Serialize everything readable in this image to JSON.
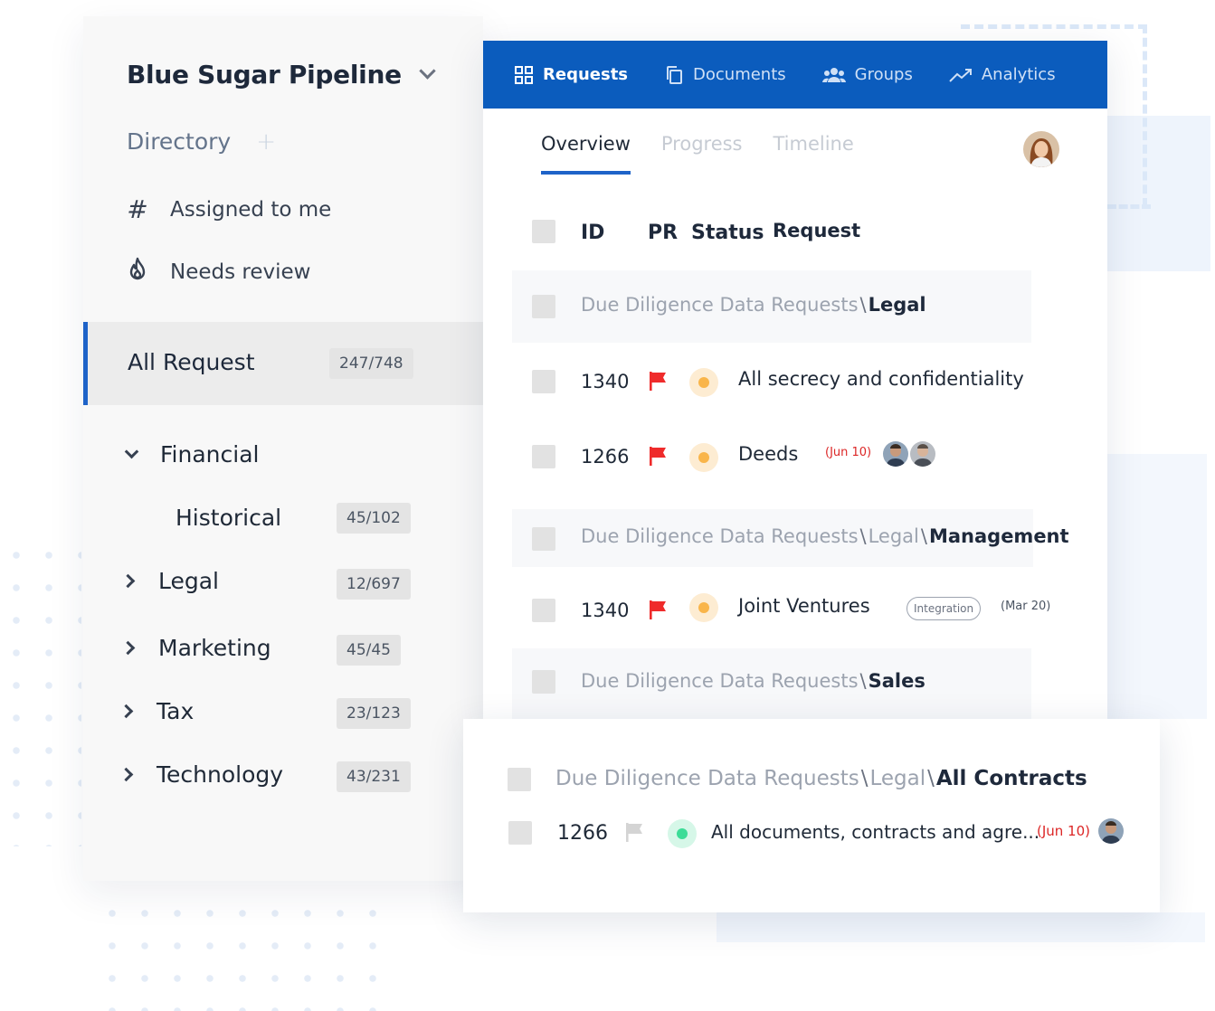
{
  "sidebar": {
    "project": "Blue Sugar Pipeline",
    "directory": "Directory",
    "quick": [
      {
        "icon": "hash-icon",
        "label": "Assigned to me"
      },
      {
        "icon": "flame-icon",
        "label": "Needs review"
      }
    ],
    "all_request": {
      "label": "All Request",
      "count": "247/748"
    },
    "tree": [
      {
        "label": "Financial",
        "expanded": true
      },
      {
        "label": "Historical",
        "count": "45/102",
        "child": true
      },
      {
        "label": "Legal",
        "count": "12/697"
      },
      {
        "label": "Marketing",
        "count": "45/45"
      },
      {
        "label": "Tax",
        "count": "23/123"
      },
      {
        "label": "Technology",
        "count": "43/231"
      }
    ]
  },
  "topnav": {
    "items": [
      {
        "label": "Requests",
        "icon": "grid-icon",
        "active": true
      },
      {
        "label": "Documents",
        "icon": "documents-icon"
      },
      {
        "label": "Groups",
        "icon": "groups-icon"
      },
      {
        "label": "Analytics",
        "icon": "trend-icon"
      }
    ]
  },
  "tabs": [
    "Overview",
    "Progress",
    "Timeline"
  ],
  "table": {
    "headers": {
      "id": "ID",
      "pr": "PR",
      "status": "Status",
      "request": "Request"
    },
    "groups": [
      {
        "path": "Due Diligence Data Requests",
        "mid": "",
        "leaf": "Legal"
      },
      {
        "path": "Due Diligence Data Requests",
        "mid": "Legal",
        "leaf": "Management"
      },
      {
        "path": "Due Diligence Data Requests",
        "mid": "",
        "leaf": "Sales"
      },
      {
        "path": "Due Diligence Data Requests",
        "mid": "Legal",
        "leaf": "All Contracts"
      }
    ],
    "rows": [
      {
        "id": "1340",
        "title": "All secrecy and confidentiality"
      },
      {
        "id": "1266",
        "title": "Deeds",
        "date": "(Jun 10)"
      },
      {
        "id": "1340",
        "title": "Joint Ventures",
        "tag": "Integration",
        "date": "(Mar 20)"
      },
      {
        "id": "1266",
        "title": "All documents, contracts and agre...",
        "date": "(Jun 10)"
      }
    ]
  },
  "colors": {
    "accent": "#0b5cbd",
    "flag_red": "#ef2b2b",
    "status_orange": "#f9b54a",
    "status_green": "#3ddc97"
  }
}
